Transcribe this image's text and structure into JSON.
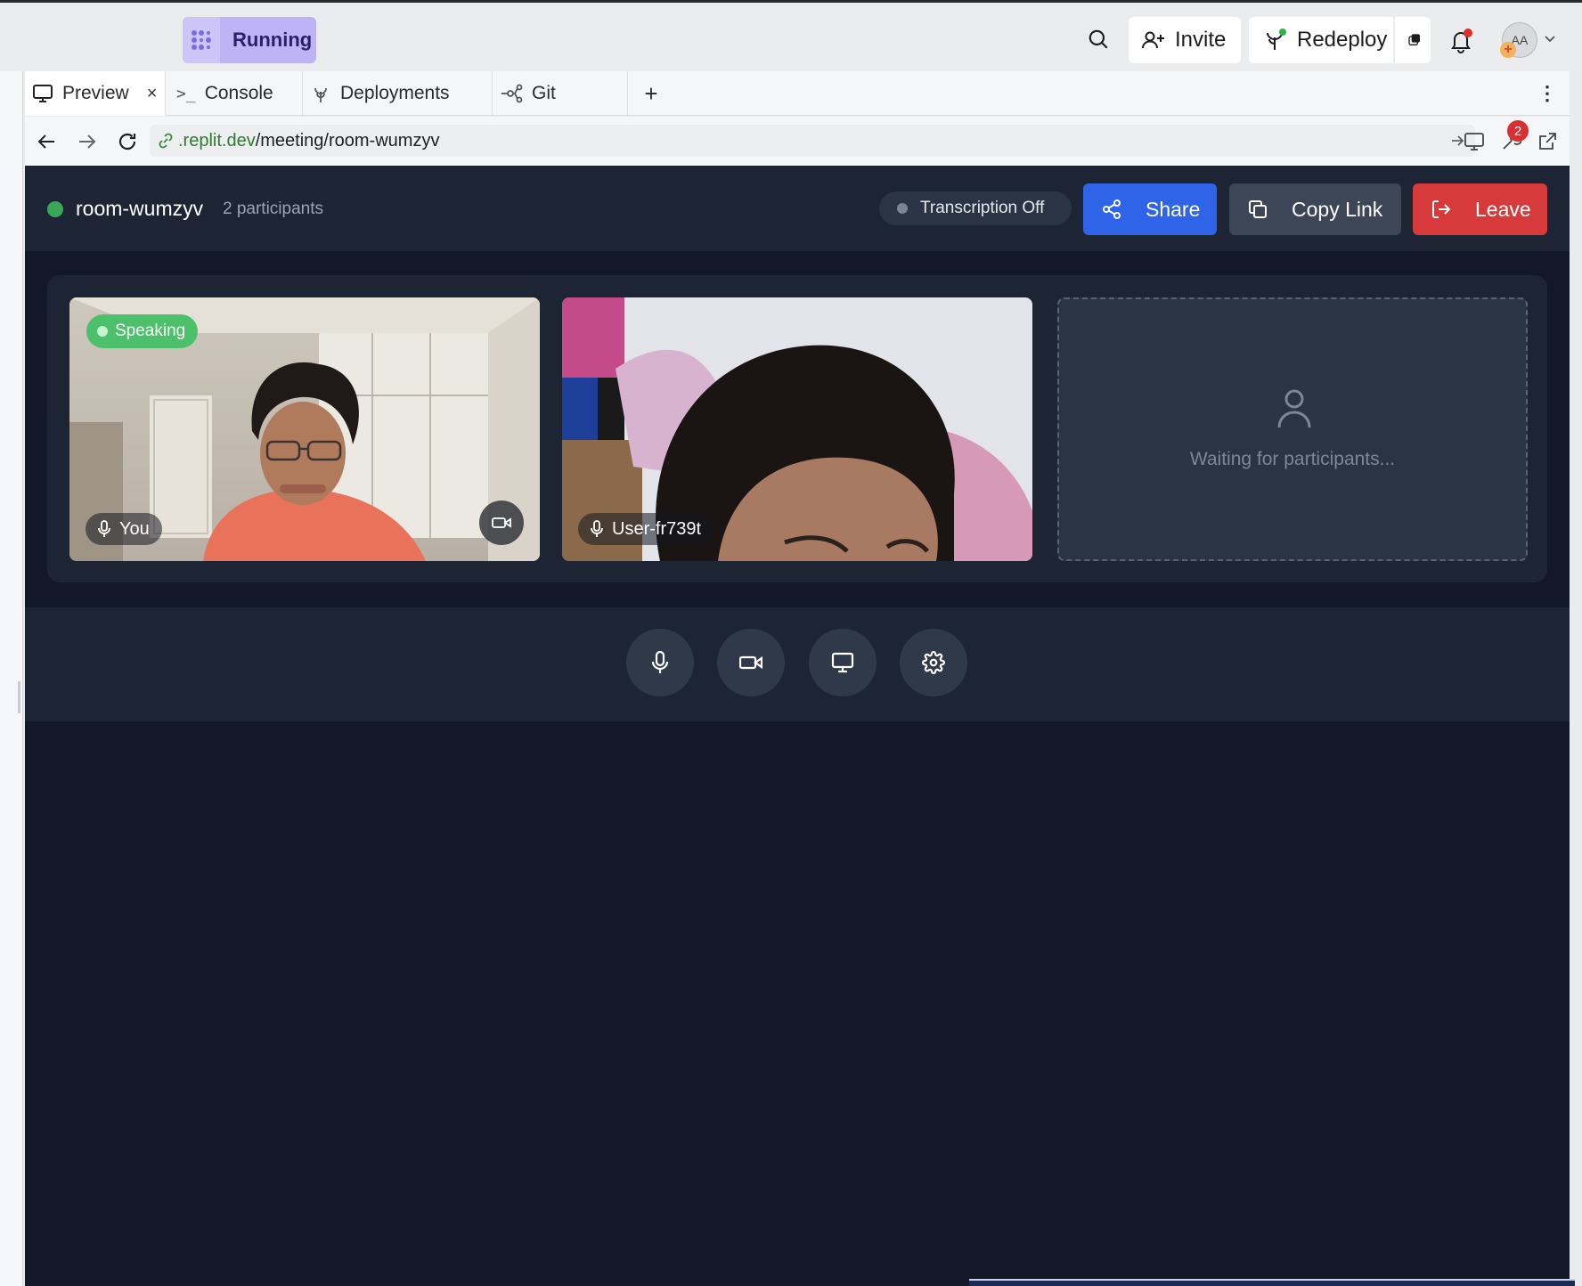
{
  "topbar": {
    "run_label": "Running",
    "invite_label": "Invite",
    "redeploy_label": "Redeploy",
    "avatar_initials": "AA"
  },
  "tabs": [
    {
      "label": "Preview",
      "icon": "monitor-icon"
    },
    {
      "label": "Console",
      "icon": "terminal-icon"
    },
    {
      "label": "Deployments",
      "icon": "deployments-icon"
    },
    {
      "label": "Git",
      "icon": "git-icon"
    }
  ],
  "urlbar": {
    "domain": ".replit.dev",
    "path": "/meeting/room-wumzyv",
    "devtools_badge": "2"
  },
  "meeting": {
    "room_name": "room-wumzyv",
    "participants": "2 participants",
    "transcription": "Transcription Off",
    "share_label": "Share",
    "copy_label": "Copy Link",
    "leave_label": "Leave",
    "speaking_label": "Speaking",
    "tiles": [
      {
        "name": "You"
      },
      {
        "name": "User-fr739t"
      }
    ],
    "waiting_text": "Waiting for participants..."
  },
  "colors": {
    "share": "#2f63e8",
    "copy": "#3d4657",
    "leave": "#d73a3a",
    "speaking": "#4cc06a",
    "running": "#bdb3f5",
    "app_bg": "#121828",
    "panel_bg": "#1d2535"
  }
}
